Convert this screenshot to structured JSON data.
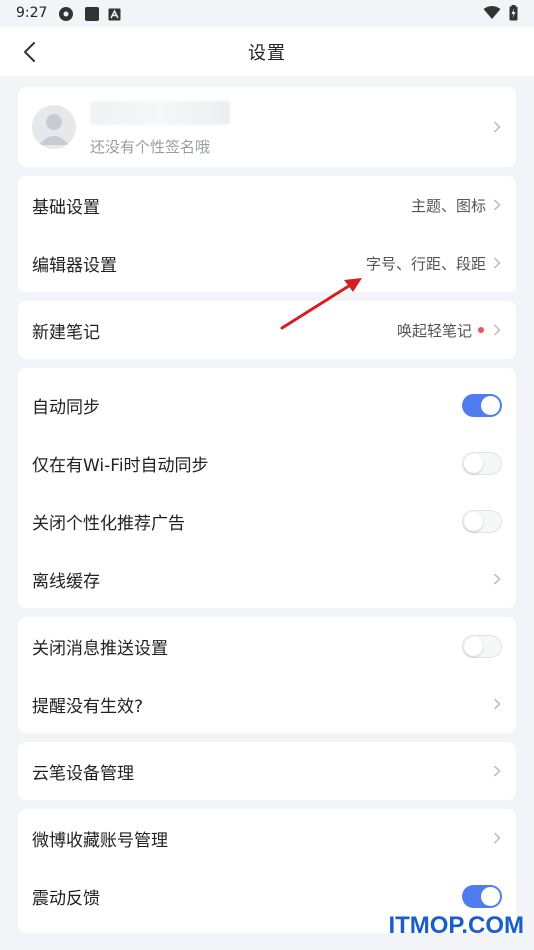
{
  "status_bar": {
    "time": "9:27"
  },
  "nav": {
    "title": "设置"
  },
  "profile": {
    "signature": "还没有个性签名哦"
  },
  "group1": [
    {
      "label": "基础设置",
      "value": "主题、图标"
    },
    {
      "label": "编辑器设置",
      "value": "字号、行距、段距"
    }
  ],
  "group2": [
    {
      "label": "新建笔记",
      "value": "唤起轻笔记",
      "badge_color": "#f0525a"
    }
  ],
  "group3": [
    {
      "label": "自动同步",
      "toggle": "on"
    },
    {
      "label": "仅在有Wi-Fi时自动同步",
      "toggle": "off"
    },
    {
      "label": "关闭个性化推荐广告",
      "toggle": "off"
    },
    {
      "label": "离线缓存"
    }
  ],
  "group4": [
    {
      "label": "关闭消息推送设置",
      "toggle": "off"
    },
    {
      "label": "提醒没有生效?"
    }
  ],
  "group5": [
    {
      "label": "云笔设备管理"
    }
  ],
  "group6": [
    {
      "label": "微博收藏账号管理"
    },
    {
      "label": "震动反馈",
      "toggle": "on"
    }
  ],
  "watermark": "ITMOP.COM",
  "colors": {
    "accent": "#4f7df0",
    "background": "#f3f4f7",
    "badge": "#f0525a",
    "annotation_arrow": "#d42020"
  }
}
